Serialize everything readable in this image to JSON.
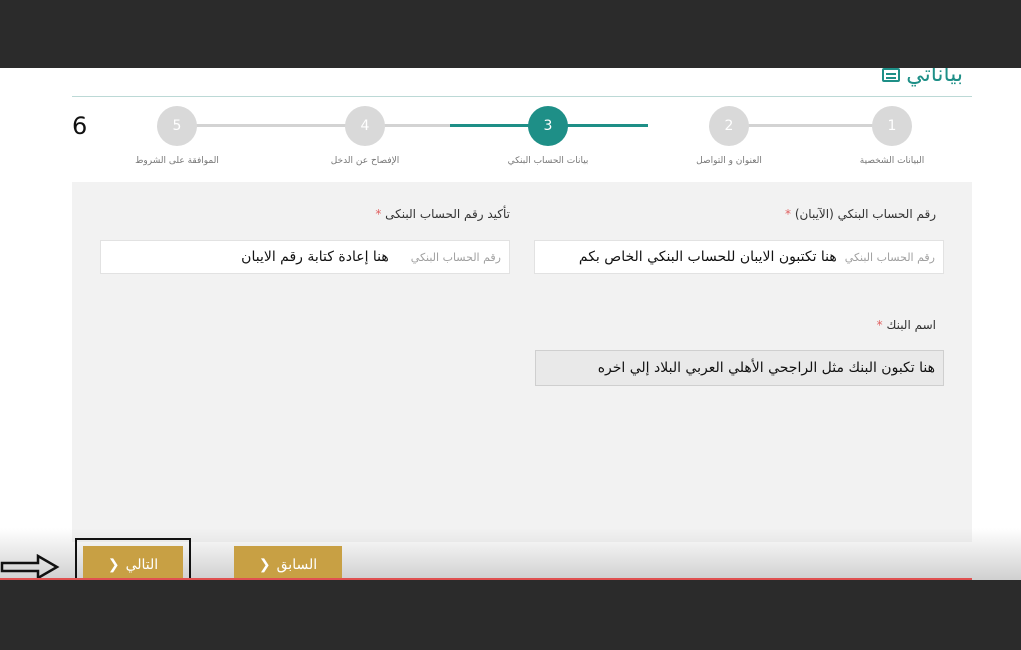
{
  "page": {
    "title": "بياناتي",
    "title_icon": "list-icon",
    "step_count": "6"
  },
  "stepper": {
    "steps": [
      {
        "number": "5",
        "label": "الموافقة على الشروط",
        "active": false
      },
      {
        "number": "4",
        "label": "الإفصاح عن الدخل",
        "active": false
      },
      {
        "number": "3",
        "label": "بيانات الحساب البنكي",
        "active": true
      },
      {
        "number": "2",
        "label": "العنوان و التواصل",
        "active": false
      },
      {
        "number": "1",
        "label": "البيانات الشخصية",
        "active": false
      }
    ],
    "active_color": "#1e8f87"
  },
  "form": {
    "iban": {
      "label": "رقم الحساب البنكي (الآيبان)",
      "required_mark": "*",
      "placeholder": "رقم الحساب البنكي",
      "value": "هنا تكتبون الايبان للحساب البنكي الخاص بكم"
    },
    "confirm_iban": {
      "label": "تأكيد رقم الحساب البنكى",
      "required_mark": "*",
      "placeholder": "رقم الحساب البنكي",
      "value": "هنا إعادة كتابة رقم الايبان"
    },
    "bank_name": {
      "label": "اسم البنك",
      "required_mark": "*",
      "value": "هنا تكبون البنك مثل الراجحي الأهلي العربي البلاد إلي اخره"
    }
  },
  "buttons": {
    "next_label": "التالي",
    "prev_label": "السابق",
    "next_icon": "chevron-left-icon",
    "prev_icon": "chevron-left-icon",
    "accent_color": "#c8a044"
  },
  "annotation": {
    "arrow_icon": "arrow-right-outline-icon"
  }
}
